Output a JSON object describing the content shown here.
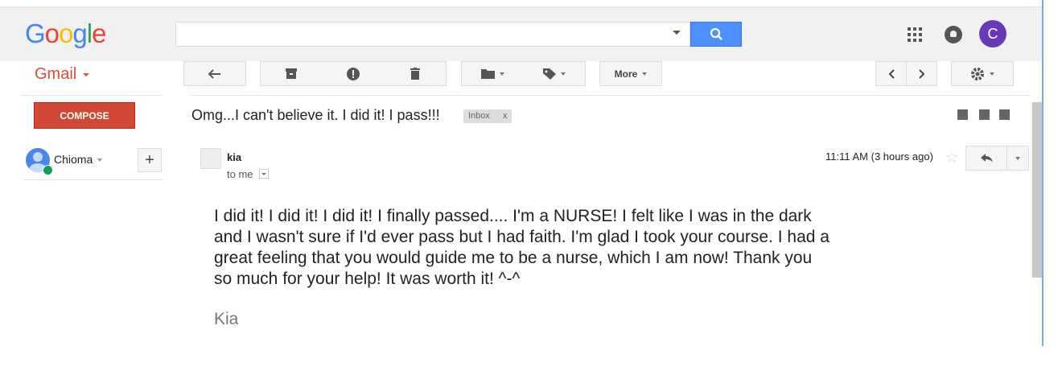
{
  "header": {
    "logo_letters": [
      "G",
      "o",
      "o",
      "g",
      "l",
      "e"
    ],
    "search": {
      "value": "",
      "placeholder": ""
    },
    "icons": [
      "apps-grid-icon",
      "notifications-icon",
      "search-icon"
    ],
    "account_initial": "C",
    "account_color": "#673ab7"
  },
  "gmail": {
    "label": "Gmail"
  },
  "toolbar": {
    "more_label": "More"
  },
  "sidebar": {
    "compose_label": "COMPOSE",
    "compose_color": "#d14836",
    "user_name": "Chioma",
    "add_label": "+"
  },
  "message": {
    "subject": "Omg...I can't believe it. I did it! I pass!!!",
    "label": "Inbox",
    "label_remove": "x",
    "sender": "kia",
    "recipient": "to me",
    "time": "11:11 AM (3 hours ago)",
    "body": "I did it! I did it! I did it!  I finally passed.... I'm a NURSE!  I felt like I was in the dark and I wasn't sure if I'd ever pass but I had faith. I'm glad I took your course. I had a great feeling that you would guide me to be a nurse, which I am now!  Thank you so much for your help!  It was worth it! ^-^",
    "signature": "Kia"
  }
}
